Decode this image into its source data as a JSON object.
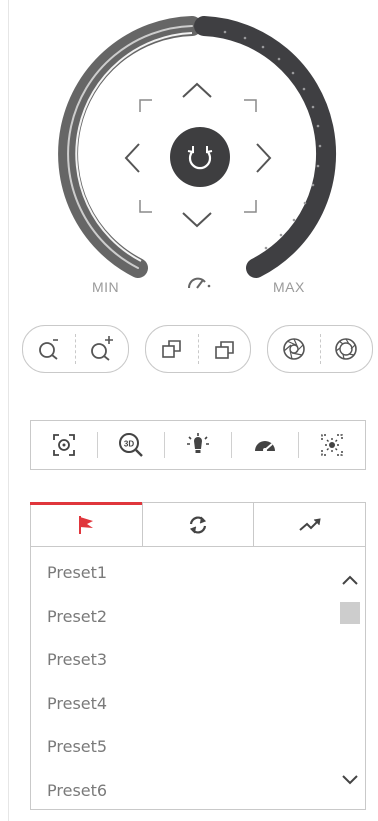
{
  "ptz_dial": {
    "min_label": "MIN",
    "max_label": "MAX",
    "icons": {
      "up": "chevron-up-icon",
      "down": "chevron-down-icon",
      "left": "chevron-left-icon",
      "right": "chevron-right-icon",
      "center": "auto-rotate-icon",
      "speed": "speedometer-icon"
    },
    "colors": {
      "left_arc": "#666666",
      "right_arc": "#3f3f42",
      "center": "#3e3e40"
    }
  },
  "lens_controls": {
    "zoom": [
      "zoom-out-icon",
      "zoom-in-icon"
    ],
    "focus": [
      "focus-near-icon",
      "focus-far-icon"
    ],
    "iris": [
      "iris-open-icon",
      "iris-close-icon"
    ]
  },
  "toolbar": {
    "icons": [
      "region-focus-icon",
      "3d-zoom-icon",
      "light-icon",
      "speed-dome-icon",
      "lens-init-icon"
    ]
  },
  "tabs": {
    "active_color": "#e0363c",
    "items": [
      "preset-flag-icon",
      "patrol-icon",
      "pattern-icon"
    ]
  },
  "presets": {
    "items": [
      "Preset1",
      "Preset2",
      "Preset3",
      "Preset4",
      "Preset5",
      "Preset6"
    ]
  }
}
